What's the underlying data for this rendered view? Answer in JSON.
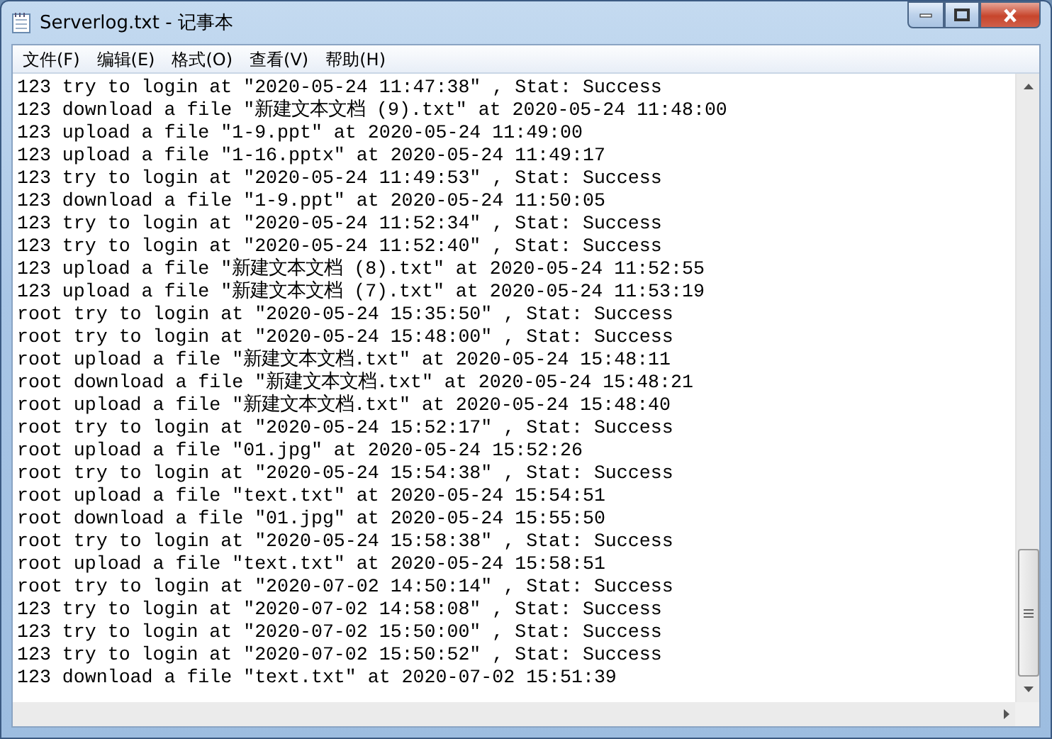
{
  "window": {
    "title": "Serverlog.txt - 记事本"
  },
  "menu": [
    "文件(F)",
    "编辑(E)",
    "格式(O)",
    "查看(V)",
    "帮助(H)"
  ],
  "lines": [
    "123 try to login at \"2020-05-24 11:47:38\" , Stat: Success",
    "123 download a file \"新建文本文档 (9).txt\" at 2020-05-24 11:48:00",
    "123 upload a file \"1-9.ppt\" at 2020-05-24 11:49:00",
    "123 upload a file \"1-16.pptx\" at 2020-05-24 11:49:17",
    "123 try to login at \"2020-05-24 11:49:53\" , Stat: Success",
    "123 download a file \"1-9.ppt\" at 2020-05-24 11:50:05",
    "123 try to login at \"2020-05-24 11:52:34\" , Stat: Success",
    "123 try to login at \"2020-05-24 11:52:40\" , Stat: Success",
    "123 upload a file \"新建文本文档 (8).txt\" at 2020-05-24 11:52:55",
    "123 upload a file \"新建文本文档 (7).txt\" at 2020-05-24 11:53:19",
    "root try to login at \"2020-05-24 15:35:50\" , Stat: Success",
    "root try to login at \"2020-05-24 15:48:00\" , Stat: Success",
    "root upload a file \"新建文本文档.txt\" at 2020-05-24 15:48:11",
    "root download a file \"新建文本文档.txt\" at 2020-05-24 15:48:21",
    "root upload a file \"新建文本文档.txt\" at 2020-05-24 15:48:40",
    "root try to login at \"2020-05-24 15:52:17\" , Stat: Success",
    "root upload a file \"01.jpg\" at 2020-05-24 15:52:26",
    "root try to login at \"2020-05-24 15:54:38\" , Stat: Success",
    "root upload a file \"text.txt\" at 2020-05-24 15:54:51",
    "root download a file \"01.jpg\" at 2020-05-24 15:55:50",
    "root try to login at \"2020-05-24 15:58:38\" , Stat: Success",
    "root upload a file \"text.txt\" at 2020-05-24 15:58:51",
    "root try to login at \"2020-07-02 14:50:14\" , Stat: Success",
    "123 try to login at \"2020-07-02 14:58:08\" , Stat: Success",
    "123 try to login at \"2020-07-02 15:50:00\" , Stat: Success",
    "123 try to login at \"2020-07-02 15:50:52\" , Stat: Success",
    "123 download a file \"text.txt\" at 2020-07-02 15:51:39"
  ]
}
